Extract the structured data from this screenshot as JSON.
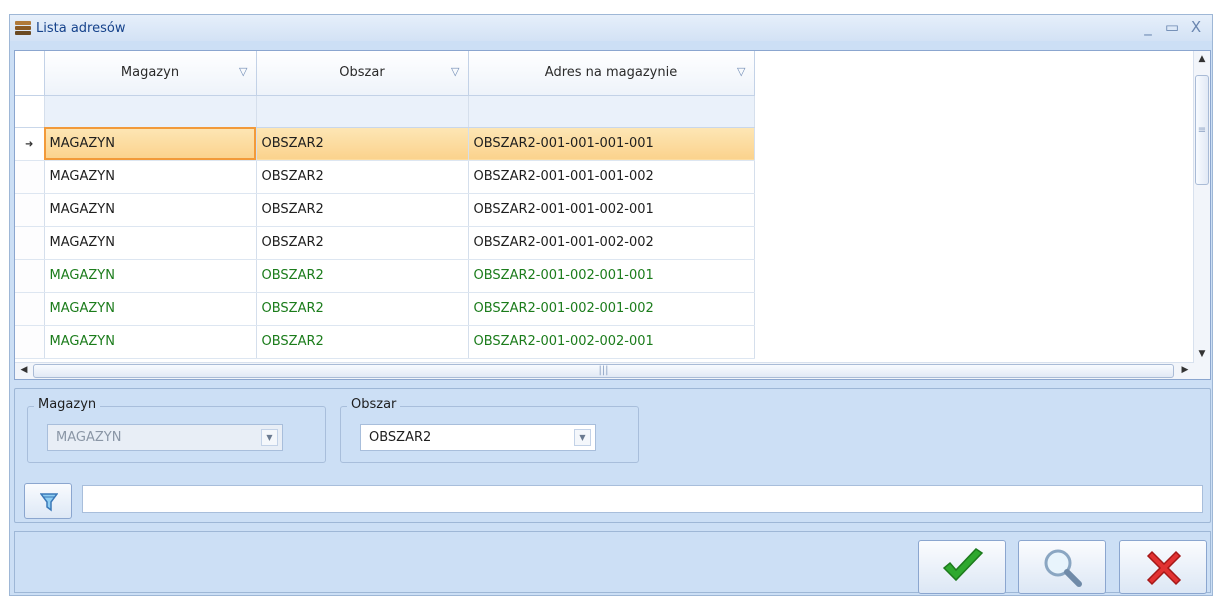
{
  "window": {
    "title": "Lista adresów",
    "controls": {
      "minimize": "_",
      "maximize": "▭",
      "close": "X"
    }
  },
  "grid": {
    "columns": [
      "Magazyn",
      "Obszar",
      "Adres na magazynie"
    ],
    "selected_row": 0,
    "rows": [
      {
        "magazyn": "MAGAZYN",
        "obszar": "OBSZAR2",
        "adres": "OBSZAR2-001-001-001-001",
        "color": "#1e1e1e"
      },
      {
        "magazyn": "MAGAZYN",
        "obszar": "OBSZAR2",
        "adres": "OBSZAR2-001-001-001-002",
        "color": "#1e1e1e"
      },
      {
        "magazyn": "MAGAZYN",
        "obszar": "OBSZAR2",
        "adres": "OBSZAR2-001-001-002-001",
        "color": "#1e1e1e"
      },
      {
        "magazyn": "MAGAZYN",
        "obszar": "OBSZAR2",
        "adres": "OBSZAR2-001-001-002-002",
        "color": "#1e1e1e"
      },
      {
        "magazyn": "MAGAZYN",
        "obszar": "OBSZAR2",
        "adres": "OBSZAR2-001-002-001-001",
        "color": "#1b7c1b"
      },
      {
        "magazyn": "MAGAZYN",
        "obszar": "OBSZAR2",
        "adres": "OBSZAR2-001-002-001-002",
        "color": "#1b7c1b"
      },
      {
        "magazyn": "MAGAZYN",
        "obszar": "OBSZAR2",
        "adres": "OBSZAR2-001-002-002-001",
        "color": "#1b7c1b"
      }
    ]
  },
  "filters": {
    "magazyn": {
      "label": "Magazyn",
      "value": "MAGAZYN",
      "enabled": false
    },
    "obszar": {
      "label": "Obszar",
      "value": "OBSZAR2",
      "enabled": true
    },
    "search_value": ""
  },
  "actions": {
    "ok_icon": "checkmark-icon",
    "preview_icon": "magnifier-icon",
    "cancel_icon": "cross-icon"
  },
  "colors": {
    "selection": "#fbd28c",
    "focus_border": "#f29a3a",
    "green_text": "#1b7c1b",
    "panel_bg": "#ccdff5"
  }
}
